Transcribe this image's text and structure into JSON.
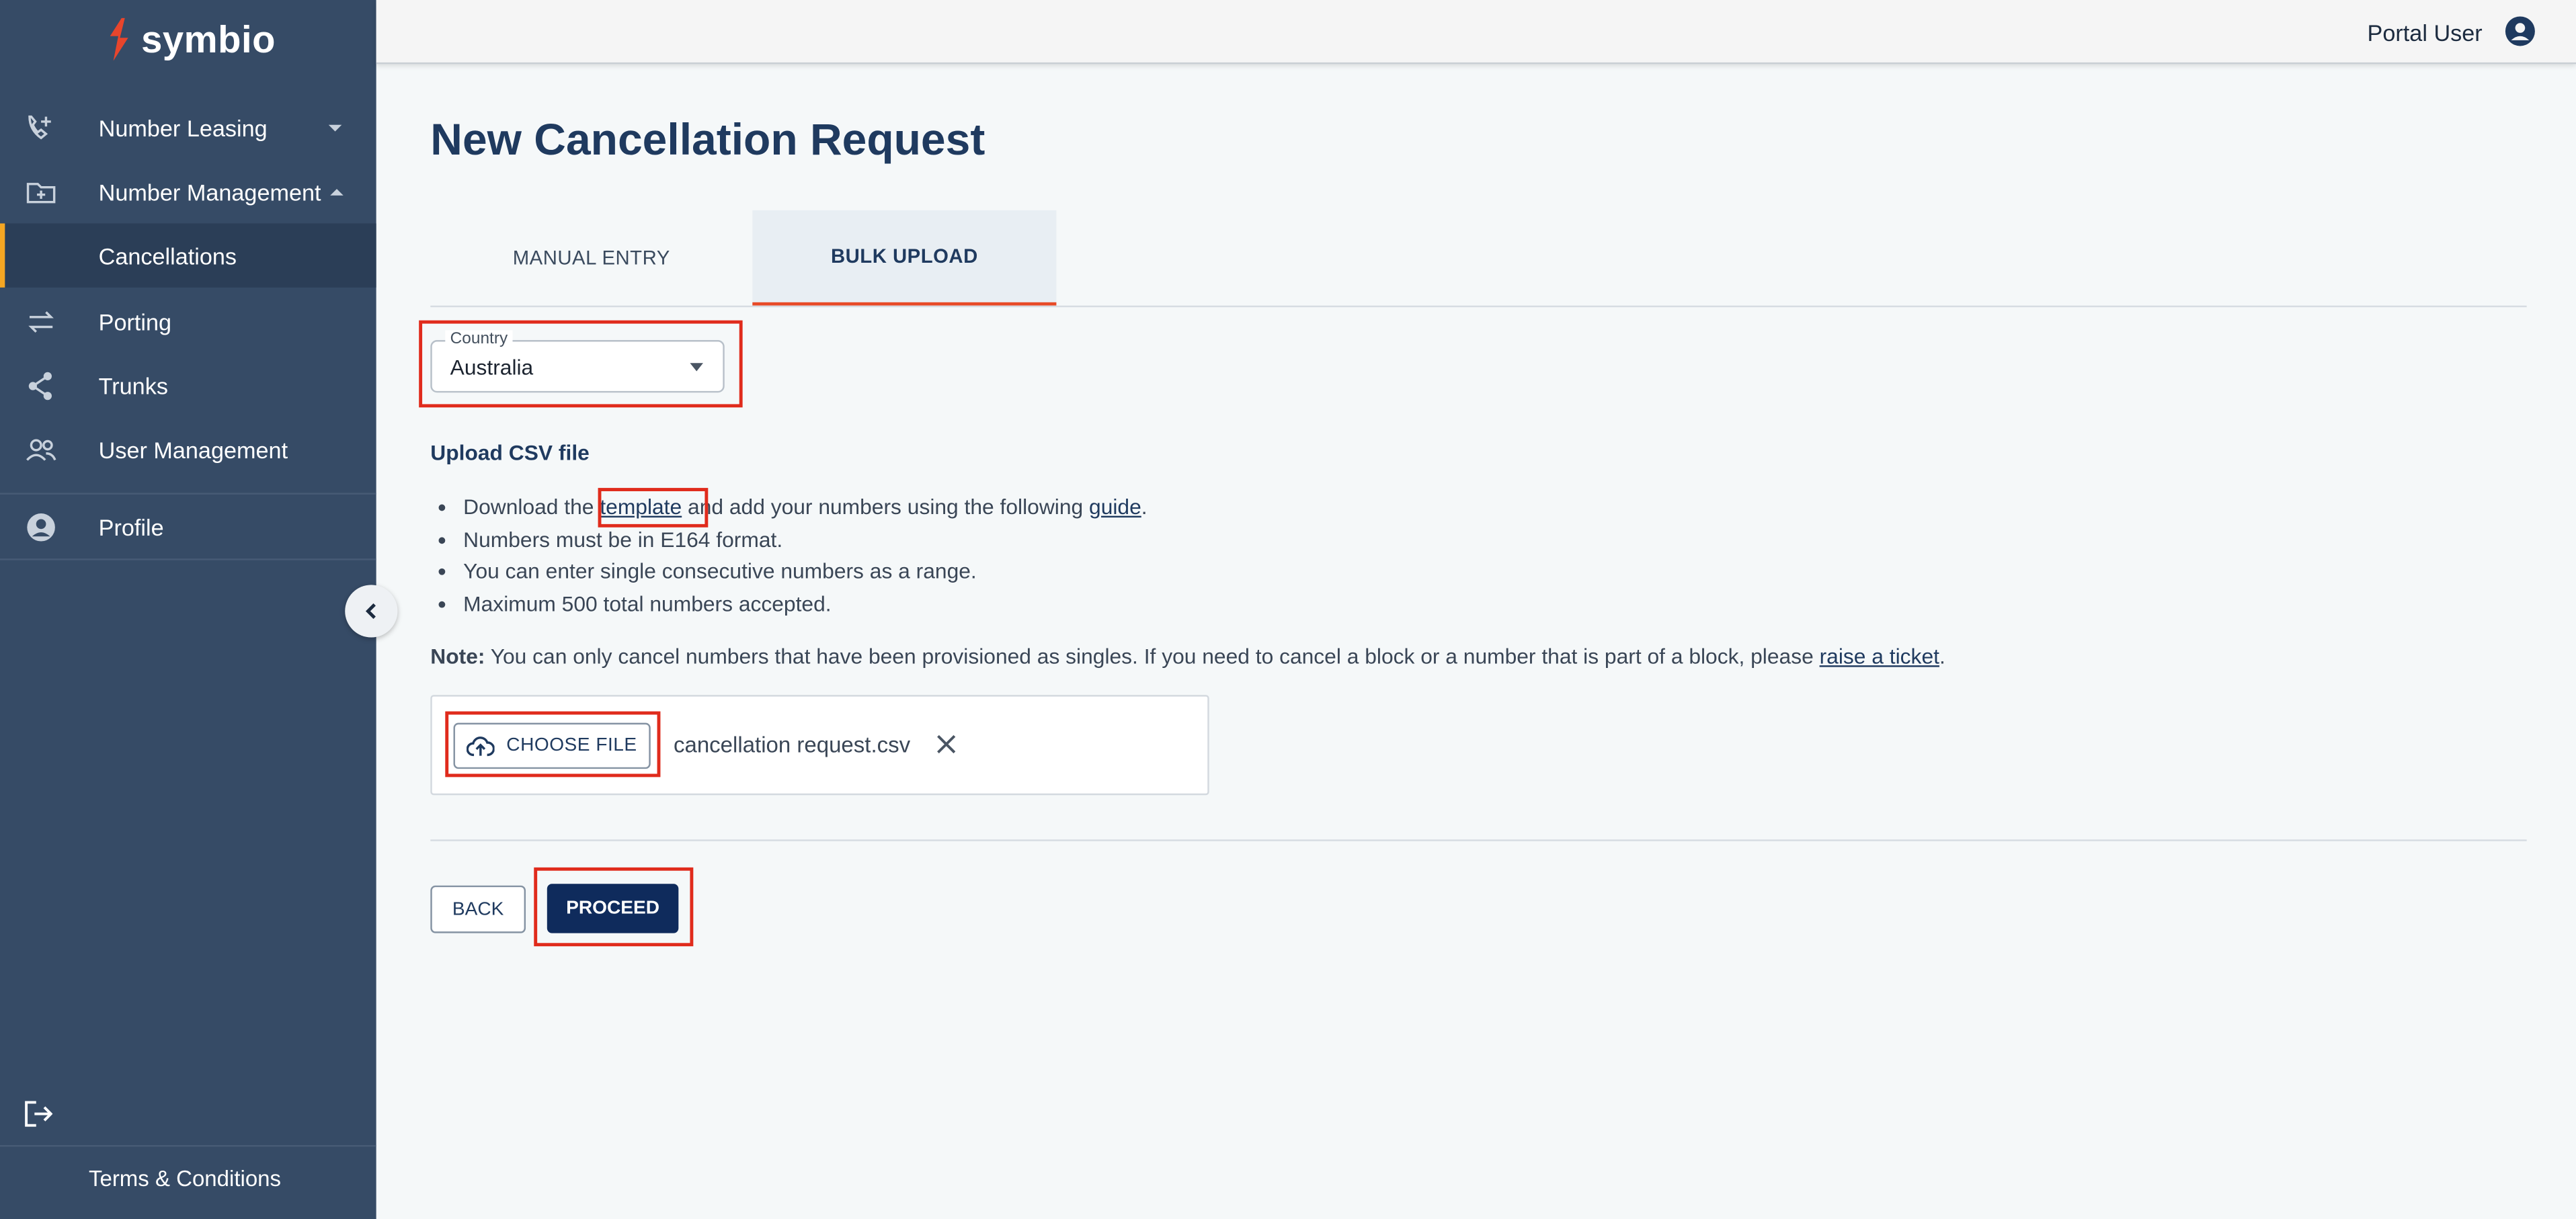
{
  "brand": {
    "logo_text": "symbio",
    "logo_color": "#e8452c"
  },
  "sidebar": {
    "items": [
      {
        "label": "Number Leasing",
        "icon": "phone-add-icon",
        "expandable": true
      },
      {
        "label": "Number Management",
        "icon": "folder-add-icon",
        "expandable": true,
        "expanded": true
      },
      {
        "label": "Cancellations",
        "selected": true
      },
      {
        "label": "Porting",
        "icon": "swap-arrows-icon"
      },
      {
        "label": "Trunks",
        "icon": "share-icon"
      },
      {
        "label": "User Management",
        "icon": "users-icon"
      },
      {
        "label": "Profile",
        "icon": "account-circle-icon"
      }
    ],
    "footer": {
      "terms_label": "Terms & Conditions",
      "logout_icon": "logout-icon"
    },
    "accent_color": "#f5a623",
    "background": "#364b66"
  },
  "header": {
    "user_label": "Portal User"
  },
  "page": {
    "title": "New Cancellation Request",
    "tabs": [
      {
        "label": "MANUAL ENTRY",
        "active": false
      },
      {
        "label": "BULK UPLOAD",
        "active": true
      }
    ],
    "country": {
      "label": "Country",
      "value": "Australia"
    },
    "upload": {
      "heading": "Upload CSV file",
      "bullet1_prefix": "Download the ",
      "bullet1_link1": "template",
      "bullet1_middle": " and add your numbers using the following ",
      "bullet1_link2": "guide",
      "bullet1_suffix": ".",
      "bullet2": "Numbers must be in E164 format.",
      "bullet3": "You can enter single consecutive numbers as a range.",
      "bullet4": "Maximum 500 total numbers accepted."
    },
    "note": {
      "label": "Note:",
      "text": " You can only cancel numbers that have been provisioned as singles. If you need to cancel a block or a number that is part of a block, please ",
      "link": "raise a ticket",
      "suffix": "."
    },
    "file": {
      "button_label": "CHOOSE FILE",
      "filename": "cancellation request.csv"
    },
    "actions": {
      "back_label": "BACK",
      "proceed_label": "PROCEED"
    }
  }
}
